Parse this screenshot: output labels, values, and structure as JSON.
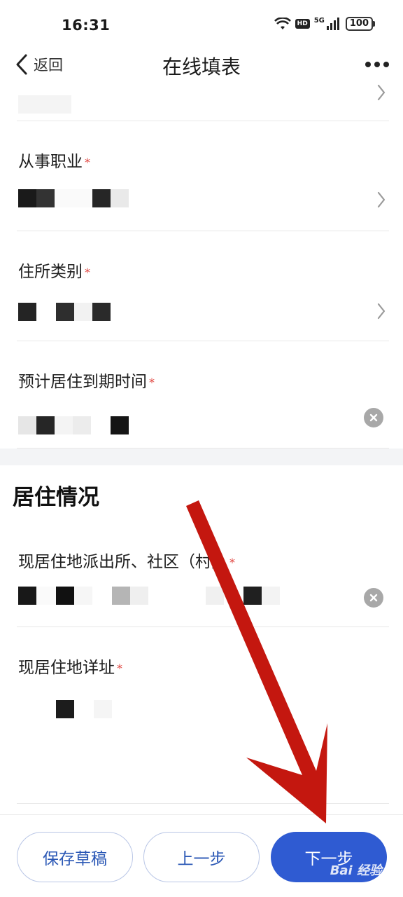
{
  "status_bar": {
    "time": "16:31",
    "hd": "HD",
    "network": "5G",
    "battery": "100"
  },
  "nav": {
    "back_label": "返回",
    "title": "在线填表"
  },
  "form": {
    "occupation": {
      "label": "从事职业"
    },
    "residence_type": {
      "label": "住所类别"
    },
    "expected_expiry": {
      "label": "预计居住到期时间"
    }
  },
  "section": {
    "title": "居住情况"
  },
  "residence": {
    "police_station": {
      "label": "现居住地派出所、社区（村）"
    },
    "address": {
      "label": "现居住地详址"
    }
  },
  "footer": {
    "save_draft": "保存草稿",
    "prev_step": "上一步",
    "next_step": "下一步"
  },
  "watermark": "Bai 经验",
  "colors": {
    "primary": "#2f5bd2",
    "required": "#e0443e",
    "arrow": "#c4170f"
  }
}
